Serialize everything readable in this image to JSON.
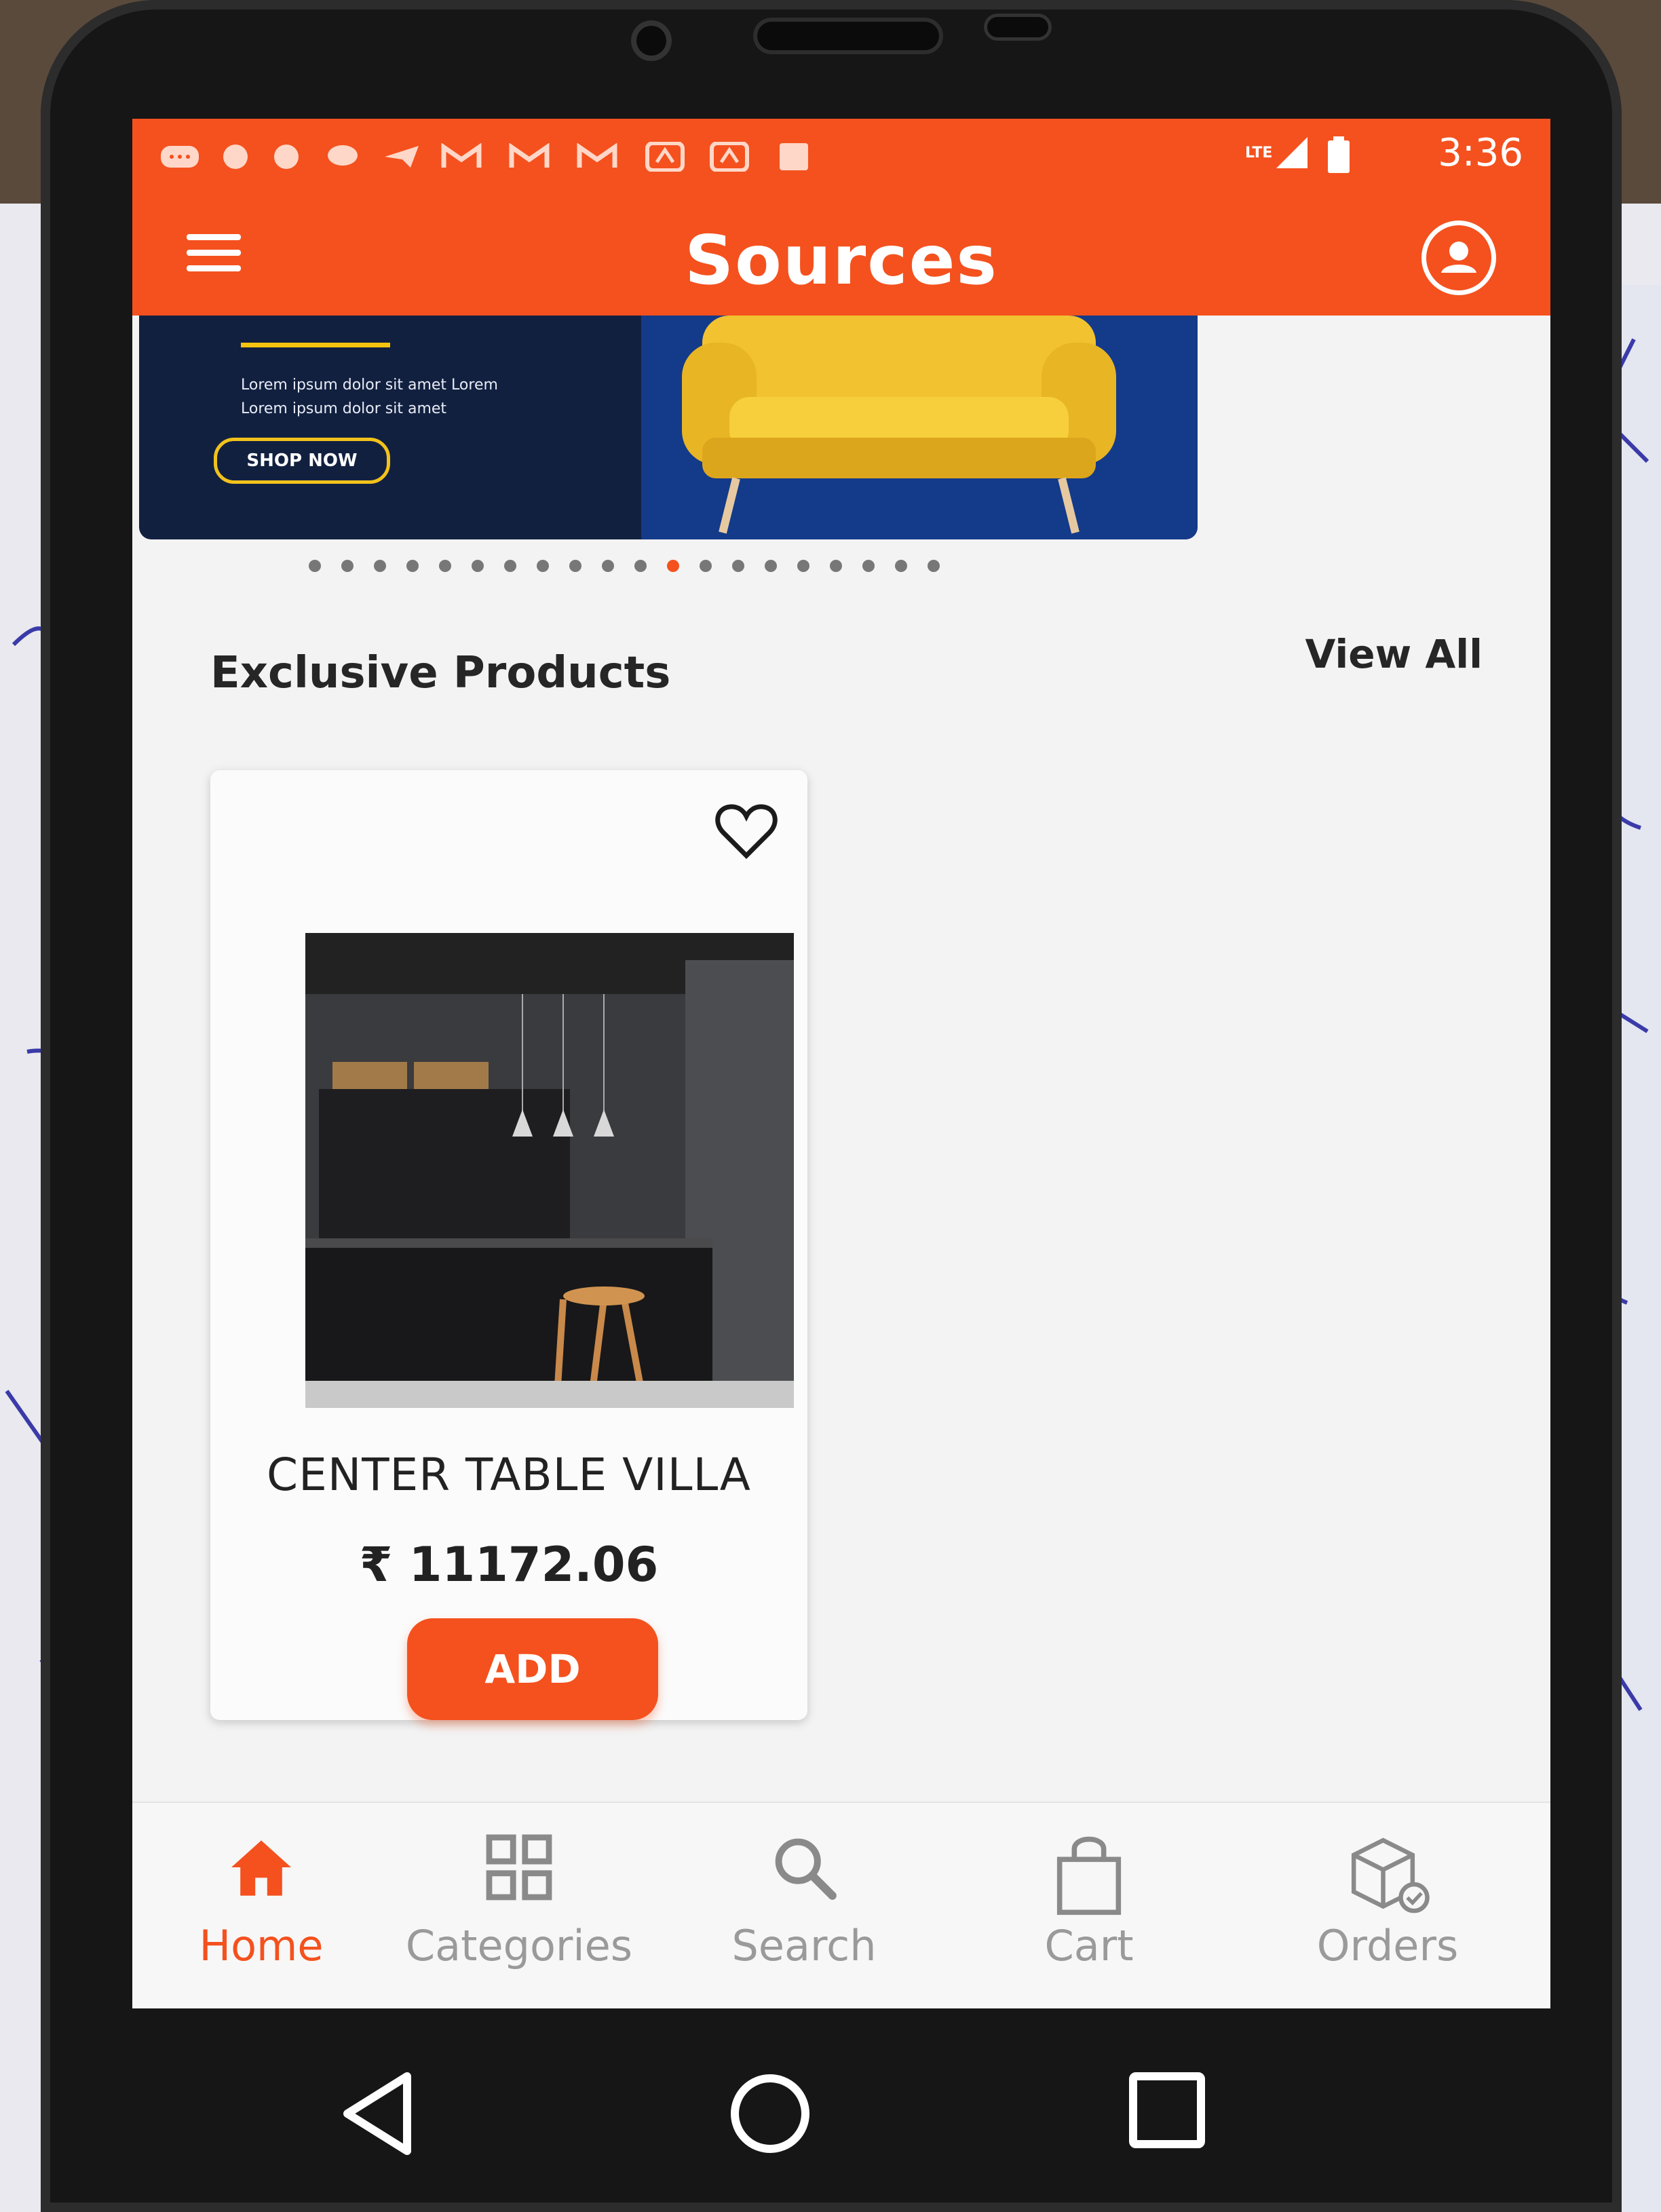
{
  "status_bar": {
    "time": "3:36",
    "network": "LTE",
    "icons": [
      "chat-icon",
      "jio-icon",
      "jio-icon",
      "message-icon",
      "telegram-icon",
      "gmail-icon",
      "gmail-icon",
      "gmail-icon",
      "saavn-icon",
      "saavn-icon",
      "square-icon"
    ]
  },
  "app_bar": {
    "title": "Sources",
    "menu_icon": "hamburger-icon",
    "profile_icon": "user-circle-icon"
  },
  "banner": {
    "text_line1": "Lorem ipsum dolor sit amet Lorem",
    "text_line2": "Lorem ipsum dolor sit amet",
    "button_label": "SHOP NOW",
    "carousel_total": 20,
    "carousel_active_index": 11,
    "colors": {
      "left": "#122040",
      "right": "#143a8a",
      "accent": "#f6c40f"
    }
  },
  "section": {
    "title": "Exclusive Products",
    "view_all_label": "View All"
  },
  "products": [
    {
      "name": "CENTER TABLE VILLA",
      "price": "₹ 11172.06",
      "add_label": "ADD",
      "wishlist_icon": "heart-outline-icon"
    }
  ],
  "bottom_nav": [
    {
      "label": "Home",
      "icon": "home-icon",
      "active": true
    },
    {
      "label": "Categories",
      "icon": "grid-icon",
      "active": false
    },
    {
      "label": "Search",
      "icon": "search-icon",
      "active": false
    },
    {
      "label": "Cart",
      "icon": "shopping-bag-icon",
      "active": false
    },
    {
      "label": "Orders",
      "icon": "package-icon",
      "active": false
    }
  ],
  "colors": {
    "brand": "#f4511e",
    "text_dark": "#262626",
    "nav_inactive": "#9a9a9a"
  }
}
